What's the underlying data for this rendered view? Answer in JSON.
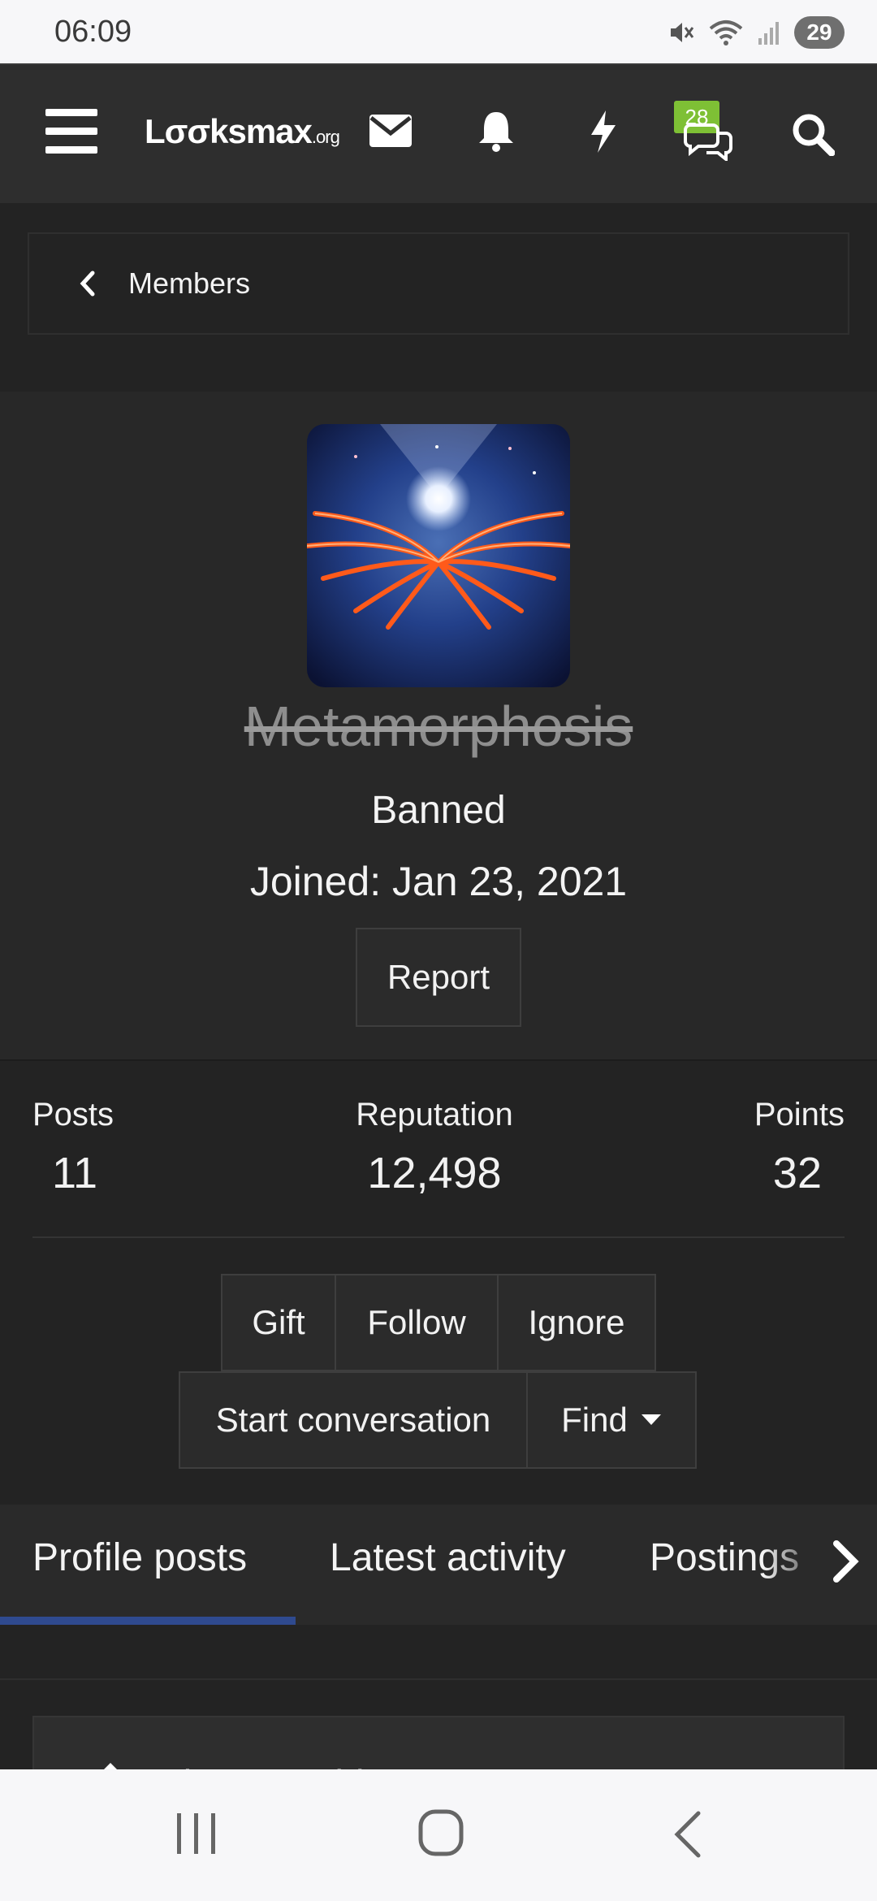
{
  "status_bar": {
    "time": "06:09",
    "battery": "29"
  },
  "header": {
    "logo_main": "Lσσksmax",
    "logo_suffix": ".org",
    "conversations_badge": "28"
  },
  "breadcrumb": {
    "label": "Members"
  },
  "profile": {
    "username": "Metamorphosis",
    "user_title": "Banned",
    "joined": "Joined: Jan 23, 2021",
    "report_label": "Report"
  },
  "stats": {
    "posts_label": "Posts",
    "posts_value": "11",
    "reputation_label": "Reputation",
    "reputation_value": "12,498",
    "points_label": "Points",
    "points_value": "32"
  },
  "actions": {
    "gift": "Gift",
    "follow": "Follow",
    "ignore": "Ignore",
    "start_conversation": "Start conversation",
    "find": "Find"
  },
  "tabs": [
    {
      "label": "Profile posts",
      "active": true
    },
    {
      "label": "Latest activity",
      "active": false
    },
    {
      "label": "Postings",
      "active": false
    }
  ],
  "composer": {
    "placeholder": "Write something..."
  },
  "colors": {
    "accent_tab": "#2f4a8f",
    "badge_green": "#7ec035",
    "background": "#232323"
  }
}
